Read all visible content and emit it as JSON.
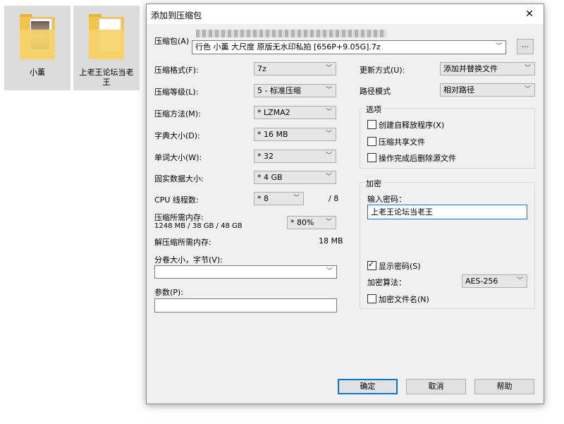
{
  "desktop": {
    "icons": [
      {
        "label": "小薰"
      },
      {
        "label": "上老王论坛当老王"
      }
    ]
  },
  "dialog": {
    "title": "添加到压缩包",
    "archive": {
      "label": "压缩包(A)",
      "value": "行色 小薰 大尺度 原版无水印私拍 [656P+9.05G].7z",
      "browse": "..."
    },
    "left": {
      "format": {
        "label": "压缩格式(F):",
        "value": "7z"
      },
      "level": {
        "label": "压缩等级(L):",
        "value": "5 - 标准压缩"
      },
      "method": {
        "label": "压缩方法(M):",
        "value": "* LZMA2"
      },
      "dict": {
        "label": "字典大小(D):",
        "value": "* 16 MB"
      },
      "word": {
        "label": "单词大小(W):",
        "value": "* 32"
      },
      "solid": {
        "label": "固实数据大小:",
        "value": "* 4 GB"
      },
      "cpu": {
        "label": "CPU 线程数:",
        "value": "* 8",
        "total": "/ 8"
      },
      "mem_compress": {
        "label": "压缩所需内存:",
        "detail": "1248 MB / 38 GB / 48 GB",
        "value": "* 80%"
      },
      "mem_decompress": {
        "label": "解压缩所需内存:",
        "value": "18 MB"
      },
      "volume": {
        "label": "分卷大小，字节(V):",
        "value": ""
      },
      "params": {
        "label": "参数(P):",
        "value": ""
      }
    },
    "right": {
      "update": {
        "label": "更新方式(U):",
        "value": "添加并替换文件"
      },
      "path": {
        "label": "路径模式",
        "value": "相对路径"
      },
      "options": {
        "title": "选项",
        "sfx": "创建自释放程序(X)",
        "shared": "压缩共享文件",
        "delete": "操作完成后删除源文件"
      },
      "encryption": {
        "title": "加密",
        "pwd_label": "输入密码：",
        "pwd_value": "上老王论坛当老王",
        "show": "显示密码(S)",
        "algo_label": "加密算法：",
        "algo_value": "AES-256",
        "encrypt_names": "加密文件名(N)"
      }
    },
    "buttons": {
      "ok": "确定",
      "cancel": "取消",
      "help": "帮助"
    }
  }
}
